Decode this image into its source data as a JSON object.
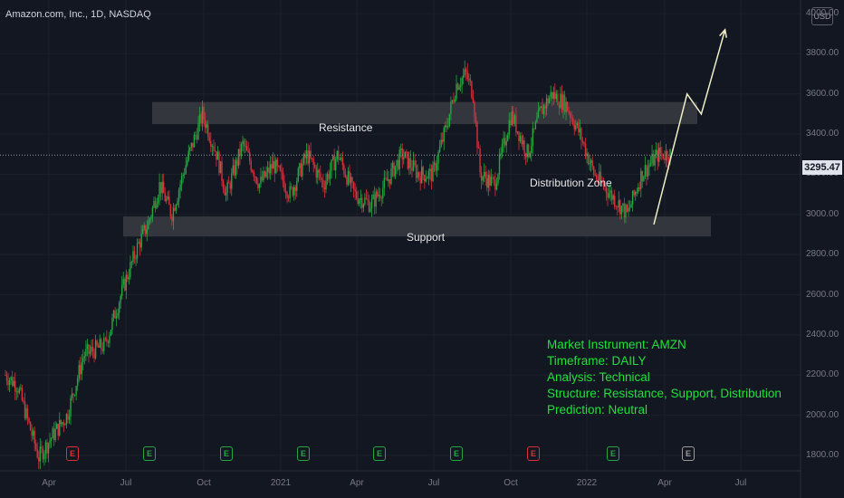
{
  "header": {
    "symbol_title": "Amazon.com, Inc., 1D, NASDAQ",
    "currency": "USD"
  },
  "last_price": "3295.47",
  "annotations": {
    "resistance": "Resistance",
    "support": "Support",
    "distribution": "Distribution Zone"
  },
  "info_box": {
    "line1": "Market Instrument: AMZN",
    "line2": "Timeframe: DAILY",
    "line3": "Analysis: Technical",
    "line4": "Structure: Resistance, Support, Distribution",
    "line5": "Prediction: Neutral"
  },
  "colors": {
    "up": "#26a641",
    "down": "#d9303a",
    "zone": "#3a3c42",
    "projection": "#f0eec6",
    "info_text": "#22e03a"
  },
  "chart_data": {
    "type": "candlestick",
    "title": "Amazon.com, Inc., 1D, NASDAQ",
    "ylim": [
      1750,
      4050
    ],
    "y_ticks": [
      "4000.00",
      "3800.00",
      "3600.00",
      "3400.00",
      "3200.00",
      "3000.00",
      "2800.00",
      "2600.00",
      "2400.00",
      "2200.00",
      "2000.00",
      "1800.00"
    ],
    "x_ticks": [
      "Apr",
      "Jul",
      "Oct",
      "2021",
      "Apr",
      "Jul",
      "Oct",
      "2022",
      "Apr",
      "Jul"
    ],
    "last_price": 3295.47,
    "zones": [
      {
        "name": "Resistance",
        "low": 3450,
        "high": 3560
      },
      {
        "name": "Support",
        "low": 2890,
        "high": 2990
      }
    ],
    "price_path": [
      [
        0,
        2200
      ],
      [
        0.5,
        2150
      ],
      [
        1.0,
        1950
      ],
      [
        1.4,
        1790
      ],
      [
        2.0,
        1900
      ],
      [
        2.6,
        2000
      ],
      [
        3.3,
        2300
      ],
      [
        4.2,
        2350
      ],
      [
        5.0,
        2650
      ],
      [
        5.6,
        2850
      ],
      [
        6.0,
        2950
      ],
      [
        6.5,
        3150
      ],
      [
        7.0,
        3000
      ],
      [
        7.6,
        3250
      ],
      [
        8.3,
        3500
      ],
      [
        8.9,
        3300
      ],
      [
        9.3,
        3100
      ],
      [
        10.0,
        3350
      ],
      [
        10.7,
        3150
      ],
      [
        11.3,
        3250
      ],
      [
        12.0,
        3100
      ],
      [
        12.7,
        3300
      ],
      [
        13.4,
        3150
      ],
      [
        14.0,
        3300
      ],
      [
        14.7,
        3100
      ],
      [
        15.4,
        3050
      ],
      [
        16.0,
        3150
      ],
      [
        16.7,
        3300
      ],
      [
        17.4,
        3200
      ],
      [
        18.0,
        3200
      ],
      [
        18.6,
        3450
      ],
      [
        19.0,
        3650
      ],
      [
        19.4,
        3700
      ],
      [
        19.7,
        3600
      ],
      [
        20.0,
        3200
      ],
      [
        20.6,
        3150
      ],
      [
        21.3,
        3500
      ],
      [
        22.0,
        3300
      ],
      [
        22.5,
        3500
      ],
      [
        23.0,
        3600
      ],
      [
        23.6,
        3550
      ],
      [
        24.2,
        3400
      ],
      [
        24.8,
        3200
      ],
      [
        25.5,
        3100
      ],
      [
        26.2,
        3000
      ],
      [
        26.8,
        3200
      ],
      [
        27.5,
        3300
      ],
      [
        28.0,
        3300
      ]
    ],
    "projection": [
      [
        28.0,
        2950
      ],
      [
        29.4,
        3600
      ],
      [
        30.0,
        3500
      ],
      [
        31.0,
        3920
      ]
    ],
    "earnings_markers": [
      "red",
      "green",
      "green",
      "green",
      "green",
      "green",
      "red",
      "green",
      "grey"
    ]
  }
}
